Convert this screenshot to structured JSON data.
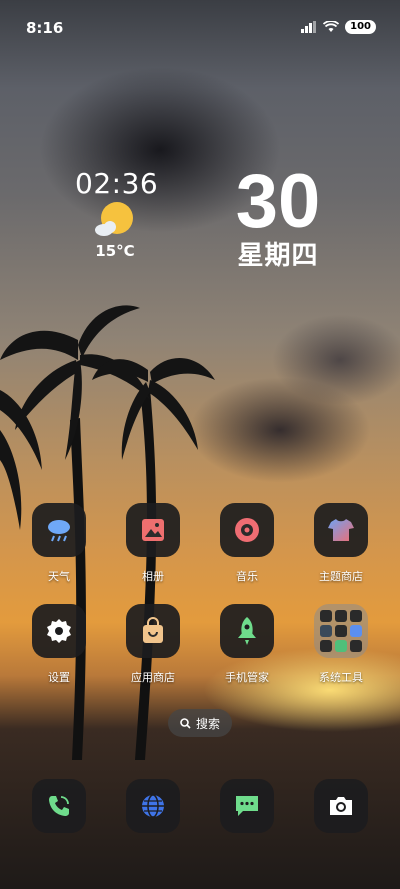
{
  "status_bar": {
    "time": "8:16",
    "battery": "100"
  },
  "clock_widget": {
    "time": "02:36",
    "temperature": "15°C"
  },
  "date_widget": {
    "day": "30",
    "weekday": "星期四"
  },
  "apps": [
    {
      "label": "天气",
      "icon": "cloud-rain-icon"
    },
    {
      "label": "相册",
      "icon": "image-icon"
    },
    {
      "label": "音乐",
      "icon": "music-disc-icon"
    },
    {
      "label": "主题商店",
      "icon": "shirt-icon"
    },
    {
      "label": "设置",
      "icon": "gear-icon"
    },
    {
      "label": "应用商店",
      "icon": "shopping-bag-icon"
    },
    {
      "label": "手机管家",
      "icon": "rocket-icon"
    },
    {
      "label": "系统工具",
      "icon": "folder-icon"
    }
  ],
  "search": {
    "label": "搜索"
  },
  "dock": [
    {
      "icon": "phone-icon"
    },
    {
      "icon": "browser-globe-icon"
    },
    {
      "icon": "message-icon"
    },
    {
      "icon": "camera-icon"
    }
  ]
}
